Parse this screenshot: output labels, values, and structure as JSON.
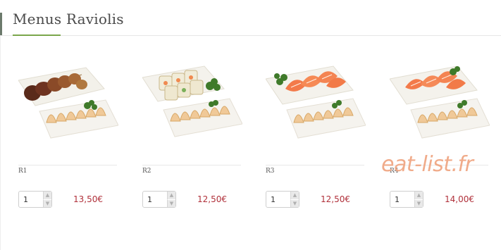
{
  "section": {
    "title": "Menus Raviolis"
  },
  "products": [
    {
      "ref": "R1",
      "quantity": "1",
      "price": "13,50€",
      "image": "yakitori-skewers-with-gyoza"
    },
    {
      "ref": "R2",
      "quantity": "1",
      "price": "12,50€",
      "image": "california-rolls-with-gyoza"
    },
    {
      "ref": "R3",
      "quantity": "1",
      "price": "12,50€",
      "image": "salmon-sashimi-with-gyoza"
    },
    {
      "ref": "R4",
      "quantity": "1",
      "price": "14,00€",
      "image": "salmon-sashimi-with-gyoza"
    }
  ],
  "watermark": "eat-list.fr",
  "colors": {
    "accent_green": "#7aa64b",
    "price_red": "#b0303a",
    "watermark": "#f0a784"
  }
}
